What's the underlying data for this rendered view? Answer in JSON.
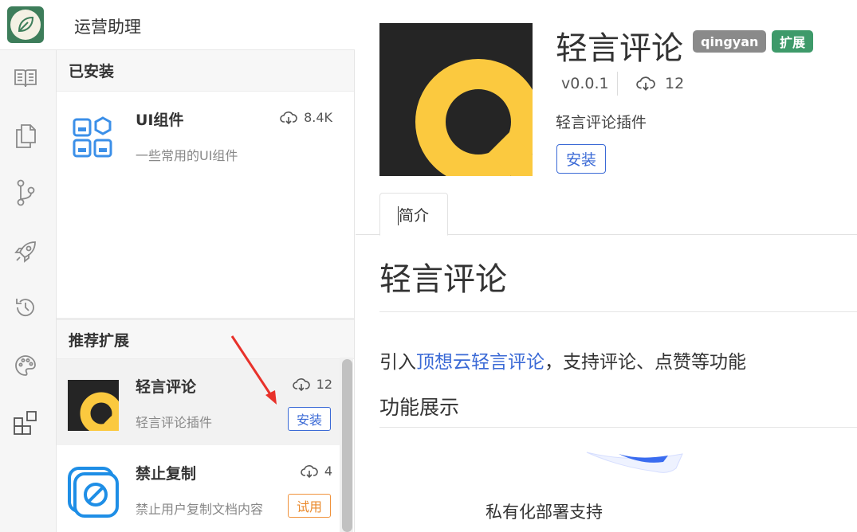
{
  "app": {
    "title": "运营助理",
    "accent": "#3b6ad6",
    "logo_color": "#3d7d5a"
  },
  "activity_bar": {
    "icons": [
      "book-icon",
      "copy-icon",
      "git-branch-icon",
      "rocket-icon",
      "history-icon",
      "palette-icon",
      "extensions-icon"
    ]
  },
  "sidebar": {
    "installed_title": "已安装",
    "installed": [
      {
        "name": "UI组件",
        "desc": "一些常用的UI组件",
        "downloads": "8.4K",
        "icon": "widgets-icon"
      }
    ],
    "recommended_title": "推荐扩展",
    "recommended": [
      {
        "name": "轻言评论",
        "desc": "轻言评论插件",
        "downloads": "12",
        "action": "安装",
        "icon": "qingyan-logo"
      },
      {
        "name": "禁止复制",
        "desc": "禁止用户复制文档内容",
        "downloads": "4",
        "action": "试用",
        "icon": "no-copy-icon"
      }
    ]
  },
  "detail": {
    "name": "轻言评论",
    "author": "qingyan",
    "type_badge": "扩展",
    "version": "v0.0.1",
    "downloads": "12",
    "description": "轻言评论插件",
    "install_label": "安装",
    "tab_label": "简介",
    "doc": {
      "title": "轻言评论",
      "para_prefix": "引入",
      "para_link": "顶想云轻言评论",
      "para_suffix": "，支持评论、点赞等功能",
      "h2": "功能展示",
      "caption": "私有化部署支持"
    }
  }
}
